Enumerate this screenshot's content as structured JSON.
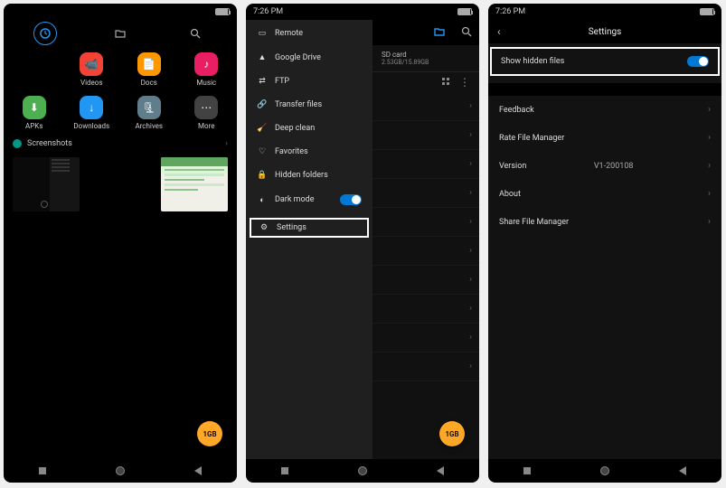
{
  "statusbar": {
    "time": "7:26 PM"
  },
  "phone1": {
    "categories": [
      {
        "label": "Videos",
        "color": "#F44336",
        "glyph": "📹"
      },
      {
        "label": "Docs",
        "color": "#FF9800",
        "glyph": "📄"
      },
      {
        "label": "Music",
        "color": "#E91E63",
        "glyph": "♪"
      },
      {
        "label": "APKs",
        "color": "#4CAF50",
        "glyph": "⬇"
      },
      {
        "label": "Downloads",
        "color": "#2196F3",
        "glyph": "↓"
      },
      {
        "label": "Archives",
        "color": "#607D8B",
        "glyph": "🗜"
      },
      {
        "label": "More",
        "color": "#424242",
        "glyph": "⋯"
      }
    ],
    "section": "Screenshots",
    "fab": "1GB"
  },
  "phone2": {
    "drawer": [
      {
        "label": "Remote",
        "icon": "▭"
      },
      {
        "label": "Google Drive",
        "icon": "▲"
      },
      {
        "label": "FTP",
        "icon": "⇄"
      },
      {
        "label": "Transfer files",
        "icon": "🔗"
      },
      {
        "label": "Deep clean",
        "icon": "🧹"
      },
      {
        "label": "Favorites",
        "icon": "♡"
      },
      {
        "label": "Hidden folders",
        "icon": "🔒"
      },
      {
        "label": "Dark mode",
        "icon": "◐",
        "toggle": true
      },
      {
        "label": "Settings",
        "icon": "⚙",
        "highlight": true
      }
    ],
    "storage": {
      "name": "SD card",
      "used": "2.53GB",
      "total": "15.89GB"
    },
    "fab": "1GB"
  },
  "phone3": {
    "title": "Settings",
    "items": [
      {
        "label": "Show hidden files",
        "toggle": true,
        "highlight": true
      },
      {
        "label": "Feedback"
      },
      {
        "label": "Rate File Manager"
      },
      {
        "label": "Version",
        "value": "V1-200108"
      },
      {
        "label": "About"
      },
      {
        "label": "Share File Manager"
      }
    ]
  }
}
